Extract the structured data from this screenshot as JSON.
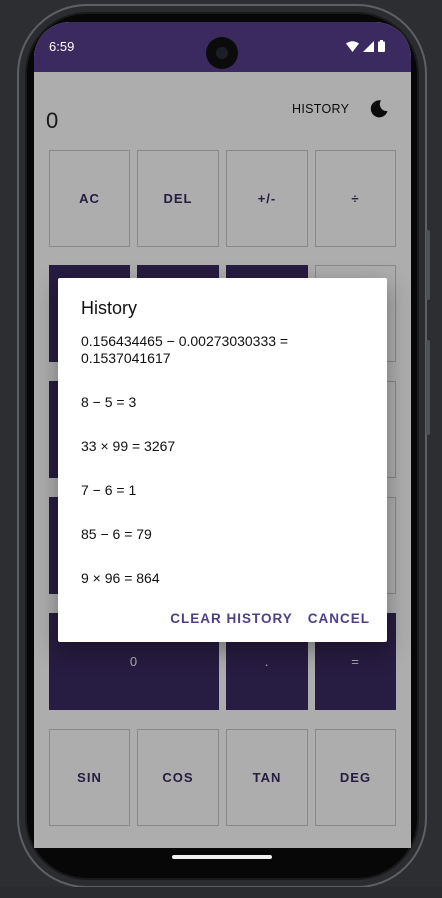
{
  "status_bar": {
    "time": "6:59"
  },
  "app": {
    "display_value": "0",
    "history_link": "HISTORY",
    "theme_icon": "moon-icon"
  },
  "keypad": {
    "row1": [
      "AC",
      "DEL",
      "+/-",
      "÷"
    ],
    "zero": "0",
    "decimal": ".",
    "equals": "=",
    "sci": [
      "SIN",
      "COS",
      "TAN",
      "DEG"
    ]
  },
  "dialog": {
    "title": "History",
    "items": [
      "0.156434465 − 0.00273030333 = 0.1537041617",
      "8 − 5 = 3",
      "33 × 99 = 3267",
      "7 − 6 = 1",
      "85 − 6 = 79",
      "9 × 96 = 864"
    ],
    "clear_label": "CLEAR HISTORY",
    "cancel_label": "CANCEL"
  },
  "colors": {
    "primary": "#3a2a60",
    "accent_text": "#4f3f88",
    "scrim": "rgba(0,0,0,0.32)"
  }
}
